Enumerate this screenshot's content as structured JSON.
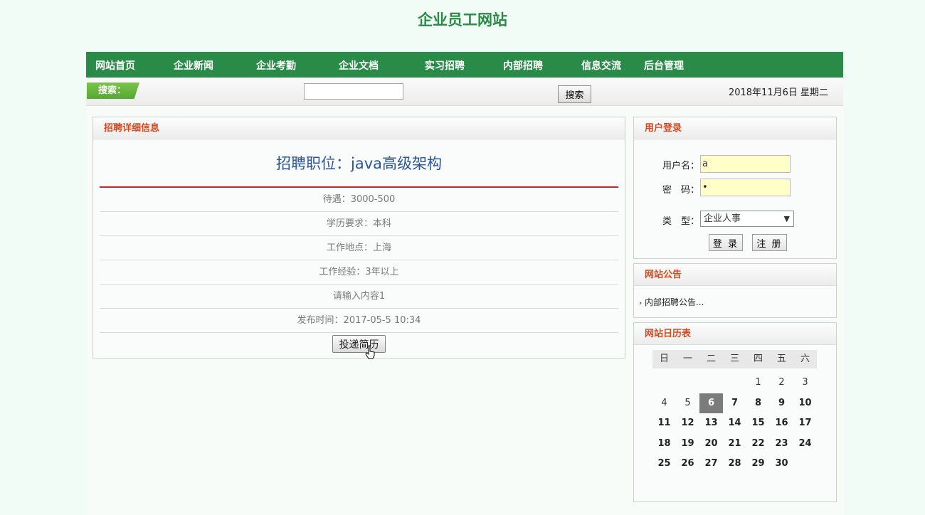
{
  "site_title": "企业员工网站",
  "nav": [
    "网站首页",
    "企业新闻",
    "企业考勤",
    "企业文档",
    "实习招聘",
    "内部招聘",
    "信息交流",
    "后台管理"
  ],
  "search": {
    "tag": "搜索：",
    "value": "",
    "button": "搜索"
  },
  "date": "2018年11月6日 星期二",
  "detail": {
    "heading": "招聘详细信息",
    "job_title": "招聘职位：java高级架构",
    "rows": [
      "待遇：3000-500",
      "学历要求：本科",
      "工作地点：上海",
      "工作经验：3年以上",
      "请输入内容1",
      "发布时间：2017-05-5 10:34"
    ],
    "apply_button": "投递简历"
  },
  "login": {
    "heading": "用户登录",
    "username_label": "用户名：",
    "username_value": "a",
    "password_label": "密　码：",
    "password_value": "•",
    "type_label": "类　型：",
    "type_value": "企业人事",
    "login_button": "登 录",
    "register_button": "注 册"
  },
  "notice": {
    "heading": "网站公告",
    "items": [
      "内部招聘公告..."
    ]
  },
  "calendar": {
    "heading": "网站日历表",
    "weekdays": [
      "日",
      "一",
      "二",
      "三",
      "四",
      "五",
      "六"
    ],
    "weeks": [
      [
        "",
        "",
        "",
        "",
        "1",
        "2",
        "3"
      ],
      [
        "4",
        "5",
        "6",
        "7",
        "8",
        "9",
        "10"
      ],
      [
        "11",
        "12",
        "13",
        "14",
        "15",
        "16",
        "17"
      ],
      [
        "18",
        "19",
        "20",
        "21",
        "22",
        "23",
        "24"
      ],
      [
        "25",
        "26",
        "27",
        "28",
        "29",
        "30",
        ""
      ]
    ],
    "today": "6"
  }
}
